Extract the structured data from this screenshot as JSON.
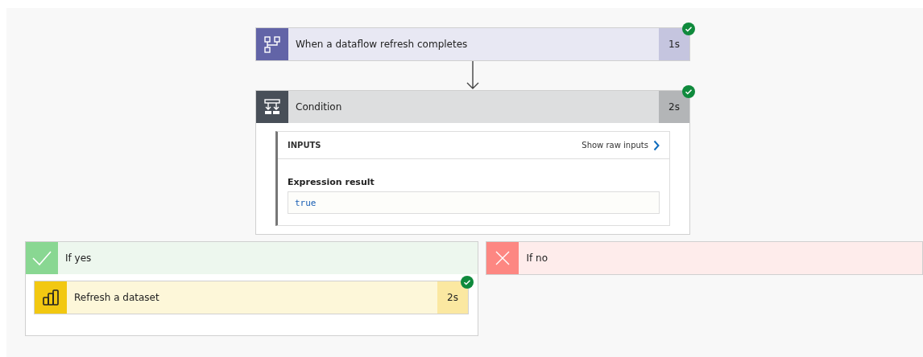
{
  "trigger": {
    "kind": "dataflow",
    "title": "When a dataflow refresh completes",
    "duration": "1s",
    "succeeded": true
  },
  "condition": {
    "kind": "condition",
    "title": "Condition",
    "duration": "2s",
    "succeeded": true,
    "inputs": {
      "header": "INPUTS",
      "link": "Show raw inputs",
      "fields": [
        {
          "label": "Expression result",
          "value": "true"
        }
      ]
    }
  },
  "branches": [
    {
      "kind": "yes",
      "title": "If yes",
      "actions": [
        {
          "kind": "powerbi",
          "title": "Refresh a dataset",
          "duration": "2s",
          "succeeded": true
        }
      ]
    },
    {
      "kind": "no",
      "title": "If no"
    }
  ]
}
